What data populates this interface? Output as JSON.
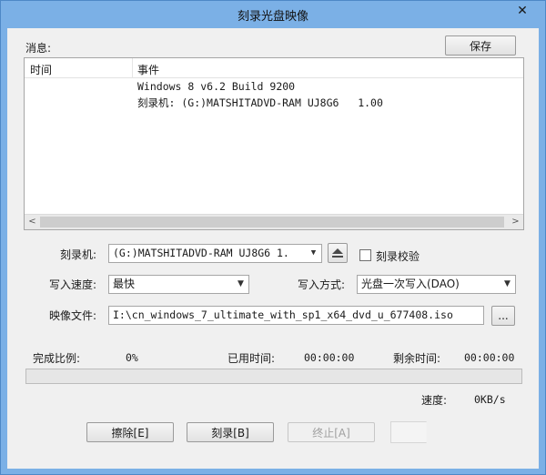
{
  "window": {
    "title": "刻录光盘映像",
    "close_label": "✕"
  },
  "messages": {
    "label": "消息:",
    "save_label": "保存",
    "columns": [
      "时间",
      "事件"
    ],
    "lines": [
      "Windows 8 v6.2 Build 9200",
      "刻录机: (G:)MATSHITADVD-RAM UJ8G6   1.00"
    ],
    "scroll_left": "<",
    "scroll_right": ">"
  },
  "burner": {
    "label": "刻录机:",
    "value": "(G:)MATSHITADVD-RAM UJ8G6   1.",
    "verify_label": "刻录校验",
    "verify_checked": false
  },
  "write_speed": {
    "label": "写入速度:",
    "value": "最快"
  },
  "write_mode": {
    "label": "写入方式:",
    "value": "光盘一次写入(DAO)"
  },
  "image_file": {
    "label": "映像文件:",
    "value": "I:\\cn_windows_7_ultimate_with_sp1_x64_dvd_u_677408.iso",
    "browse_label": "..."
  },
  "status": {
    "progress_label": "完成比例:",
    "progress_value": "0%",
    "progress_fraction": 0,
    "elapsed_label": "已用时间:",
    "elapsed_value": "00:00:00",
    "remaining_label": "剩余时间:",
    "remaining_value": "00:00:00",
    "speed_label": "速度:",
    "speed_value": "0KB/s"
  },
  "buttons": {
    "erase_label": "擦除[E]",
    "burn_label": "刻录[B]",
    "stop_label": "终止[A]"
  },
  "colors": {
    "titlebar": "#7bb0e6",
    "progress_fill": "#06b025"
  }
}
